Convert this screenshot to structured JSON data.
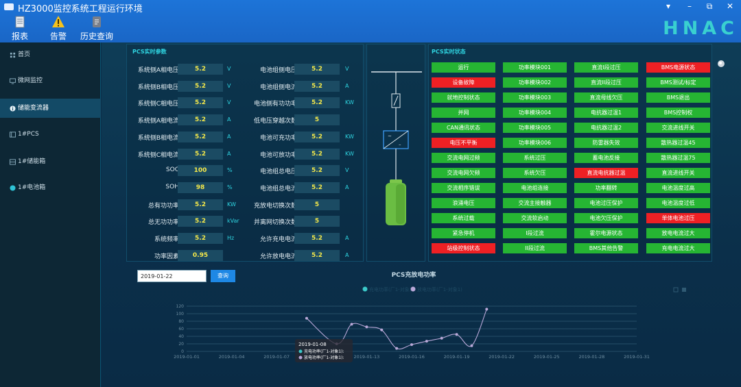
{
  "window": {
    "title": "HZ3000监控系统工程运行环境",
    "controls": [
      "▾",
      "–",
      "⧉",
      "✕"
    ]
  },
  "toolbar": {
    "buttons": [
      {
        "label": "报表",
        "icon": "report-icon"
      },
      {
        "label": "告警",
        "icon": "warning-icon"
      },
      {
        "label": "历史查询",
        "icon": "history-icon"
      }
    ]
  },
  "brand": "HNAC",
  "sidebar": {
    "items": [
      {
        "label": "首页",
        "active": false
      },
      {
        "label": "微网监控",
        "active": false
      },
      {
        "label": "储能变流器",
        "active": true
      },
      {
        "label": "1#PCS",
        "active": false
      },
      {
        "label": "1#储能箱",
        "active": false
      },
      {
        "label": "1#电池箱",
        "active": false
      }
    ]
  },
  "params": {
    "title": "PCS实时参数",
    "left": [
      {
        "label": "系统侧A相电压",
        "value": "5.2",
        "unit": "V"
      },
      {
        "label": "系统侧B相电压",
        "value": "5.2",
        "unit": "V"
      },
      {
        "label": "系统侧C相电压",
        "value": "5.2",
        "unit": "V"
      },
      {
        "label": "系统侧A相电流",
        "value": "5.2",
        "unit": "A"
      },
      {
        "label": "系统侧B相电流",
        "value": "5.2",
        "unit": "A"
      },
      {
        "label": "系统侧C相电流",
        "value": "5.2",
        "unit": "A"
      },
      {
        "label": "SOC",
        "value": "100",
        "unit": "%"
      },
      {
        "label": "SOH",
        "value": "98",
        "unit": "%"
      },
      {
        "label": "总有功功率",
        "value": "5.2",
        "unit": "KW"
      },
      {
        "label": "总无功功率",
        "value": "5.2",
        "unit": "kVar"
      },
      {
        "label": "系统频率",
        "value": "5.2",
        "unit": "Hz"
      },
      {
        "label": "功率因素",
        "value": "0.95",
        "unit": ""
      }
    ],
    "right": [
      {
        "label": "电池组侧电压",
        "value": "5.2",
        "unit": "V"
      },
      {
        "label": "电池组侧电流",
        "value": "5.2",
        "unit": "A"
      },
      {
        "label": "电池侧有功功率",
        "value": "5.2",
        "unit": "KW"
      },
      {
        "label": "低电压穿越次数",
        "value": "5",
        "unit": ""
      },
      {
        "label": "电池可充功率",
        "value": "5.2",
        "unit": "KW"
      },
      {
        "label": "电池可放功率",
        "value": "5.2",
        "unit": "KW"
      },
      {
        "label": "电池组总电压",
        "value": "5.2",
        "unit": "V"
      },
      {
        "label": "电池组总电流",
        "value": "5.2",
        "unit": "A"
      },
      {
        "label": "充放电切换次数",
        "value": "5",
        "unit": ""
      },
      {
        "label": "并离网切换次数",
        "value": "5",
        "unit": ""
      },
      {
        "label": "允许充电电流",
        "value": "5.2",
        "unit": "A"
      },
      {
        "label": "允许放电电流",
        "value": "5.2",
        "unit": "A"
      }
    ]
  },
  "status": {
    "title": "PCS实时状态",
    "columns": [
      [
        {
          "label": "运行",
          "alarm": false
        },
        {
          "label": "设备故障",
          "alarm": true
        },
        {
          "label": "就地控制状态",
          "alarm": false
        },
        {
          "label": "并网",
          "alarm": false
        },
        {
          "label": "CAN通讯状态",
          "alarm": false
        },
        {
          "label": "电压不平衡",
          "alarm": true
        },
        {
          "label": "交流电网过频",
          "alarm": false
        },
        {
          "label": "交流电网欠频",
          "alarm": false
        },
        {
          "label": "交流相序错误",
          "alarm": false
        },
        {
          "label": "浪涌电压",
          "alarm": false
        },
        {
          "label": "系统过载",
          "alarm": false
        },
        {
          "label": "紧急停机",
          "alarm": false
        },
        {
          "label": "站级控制状态",
          "alarm": true
        }
      ],
      [
        {
          "label": "功率模块001",
          "alarm": false
        },
        {
          "label": "功率模块002",
          "alarm": false
        },
        {
          "label": "功率模块003",
          "alarm": false
        },
        {
          "label": "功率模块004",
          "alarm": false
        },
        {
          "label": "功率模块005",
          "alarm": false
        },
        {
          "label": "功率模块006",
          "alarm": false
        },
        {
          "label": "系统过压",
          "alarm": false
        },
        {
          "label": "系统欠压",
          "alarm": false
        },
        {
          "label": "电池组连接",
          "alarm": false
        },
        {
          "label": "交流主接触器",
          "alarm": false
        },
        {
          "label": "交流软启动",
          "alarm": false
        },
        {
          "label": "I段过流",
          "alarm": false
        },
        {
          "label": "II段过流",
          "alarm": false
        }
      ],
      [
        {
          "label": "直流I段过压",
          "alarm": false
        },
        {
          "label": "直流II段过压",
          "alarm": false
        },
        {
          "label": "直流母线欠压",
          "alarm": false
        },
        {
          "label": "电抗器过温1",
          "alarm": false
        },
        {
          "label": "电抗器过温2",
          "alarm": false
        },
        {
          "label": "防雷器失效",
          "alarm": false
        },
        {
          "label": "蓄电池反接",
          "alarm": false
        },
        {
          "label": "直流电抗器过温",
          "alarm": true
        },
        {
          "label": "功率翻转",
          "alarm": false
        },
        {
          "label": "电池过压保护",
          "alarm": false
        },
        {
          "label": "电池欠压保护",
          "alarm": false
        },
        {
          "label": "霍尔电源状态",
          "alarm": false
        },
        {
          "label": "BMS其他告警",
          "alarm": false
        }
      ],
      [
        {
          "label": "BMS电源状态",
          "alarm": true
        },
        {
          "label": "BMS测试/标定",
          "alarm": false
        },
        {
          "label": "BMS退出",
          "alarm": false
        },
        {
          "label": "BMS控制权",
          "alarm": false
        },
        {
          "label": "交流进线开关",
          "alarm": false
        },
        {
          "label": "散热器过温45",
          "alarm": false
        },
        {
          "label": "散热器过温75",
          "alarm": false
        },
        {
          "label": "直流进线开关",
          "alarm": false
        },
        {
          "label": "电池温度过高",
          "alarm": false
        },
        {
          "label": "电池温度过低",
          "alarm": false
        },
        {
          "label": "单体电池过压",
          "alarm": true
        },
        {
          "label": "放电电流过大",
          "alarm": false
        },
        {
          "label": "充电电流过大",
          "alarm": false
        }
      ]
    ]
  },
  "query": {
    "date_value": "2019-01-22",
    "button_label": "查询"
  },
  "chart_data": {
    "type": "line",
    "title": "PCS充放电功率",
    "x": [
      "2019-01-01",
      "2019-01-02",
      "2019-01-03",
      "2019-01-04",
      "2019-01-05",
      "2019-01-06",
      "2019-01-07",
      "2019-01-08",
      "2019-01-09",
      "2019-01-10",
      "2019-01-11",
      "2019-01-12",
      "2019-01-13",
      "2019-01-14",
      "2019-01-15",
      "2019-01-16",
      "2019-01-17",
      "2019-01-18",
      "2019-01-19",
      "2019-01-20",
      "2019-01-21",
      "2019-01-22",
      "2019-01-23",
      "2019-01-24",
      "2019-01-25",
      "2019-01-26",
      "2019-01-27",
      "2019-01-28",
      "2019-01-29",
      "2019-01-30",
      "2019-01-31"
    ],
    "x_ticks": [
      "2019-01-01",
      "2019-01-04",
      "2019-01-07",
      "2019-01-10",
      "2019-01-13",
      "2019-01-16",
      "2019-01-19",
      "2019-01-22",
      "2019-01-25",
      "2019-01-28",
      "2019-01-31"
    ],
    "y_ticks": [
      0,
      20,
      40,
      60,
      80,
      100,
      120
    ],
    "ylim": [
      0,
      120
    ],
    "series": [
      {
        "name": "充电功率(厂1-对象1)",
        "color": "#3bc9c9",
        "values": []
      },
      {
        "name": "放电功率(厂1-对象1)",
        "color": "#b9a8d8",
        "values": [
          null,
          null,
          null,
          null,
          null,
          null,
          null,
          null,
          88,
          null,
          20,
          72,
          65,
          57,
          8,
          18,
          27,
          35,
          45,
          15,
          112,
          null,
          null,
          null,
          null,
          null,
          null,
          null,
          null,
          null,
          null
        ]
      }
    ],
    "tooltip": {
      "date": "2019-01-08",
      "lines": [
        "充电功率(厂1-对象1):",
        "放电功率(厂1-对象1):"
      ]
    }
  }
}
